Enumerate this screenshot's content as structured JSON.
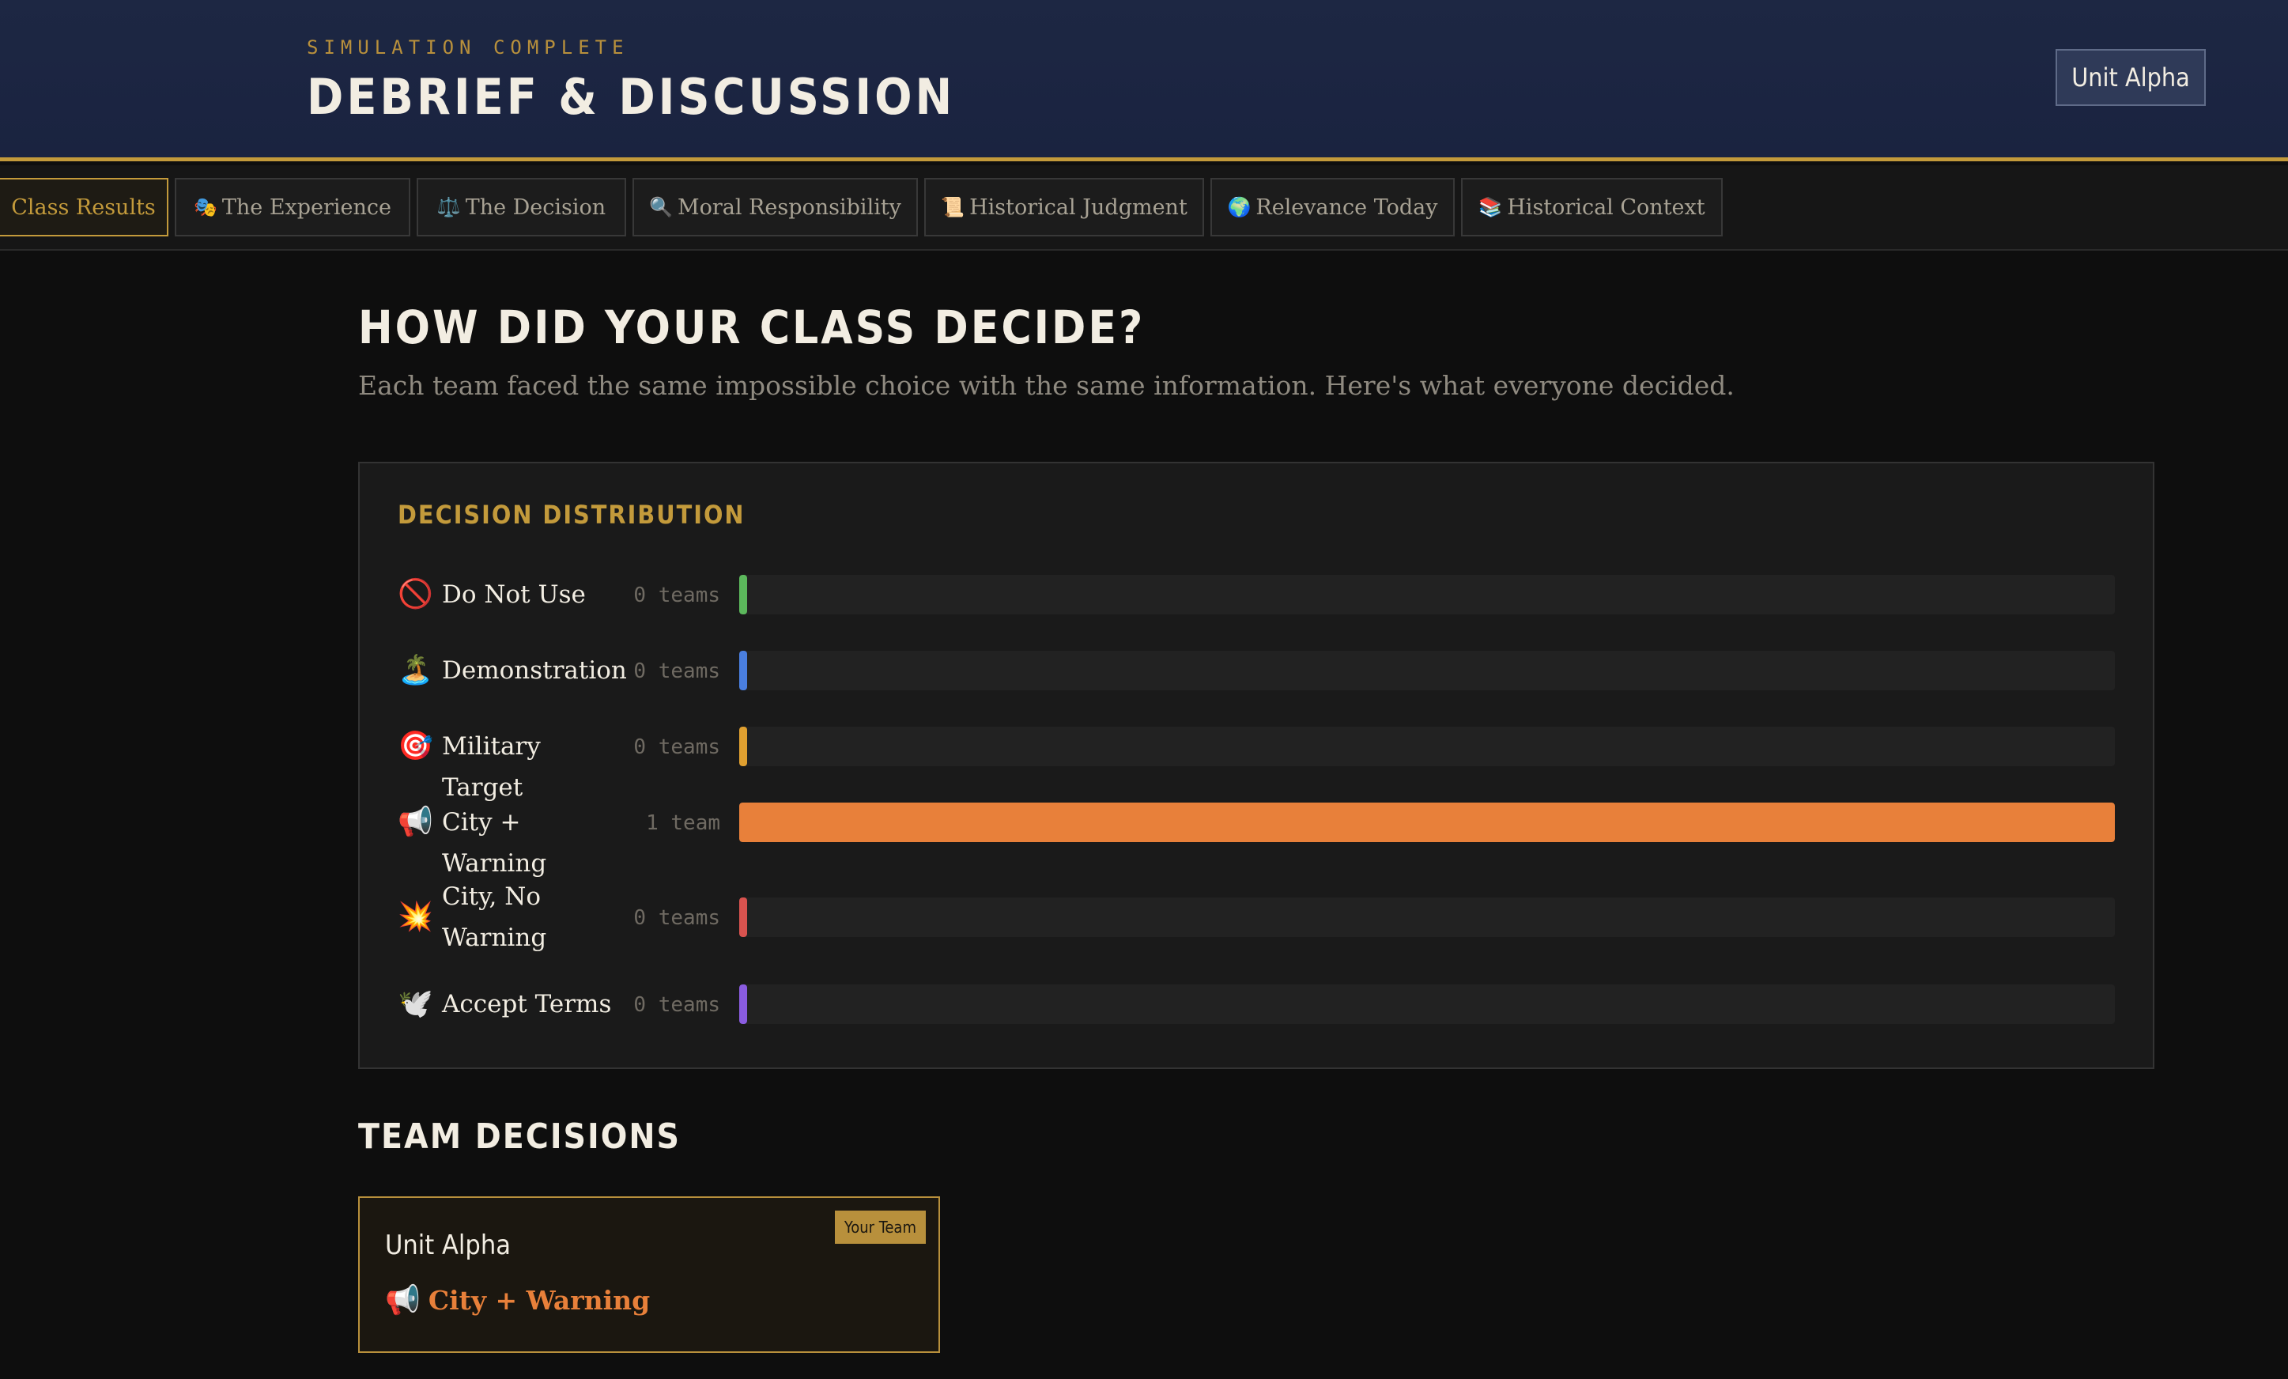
{
  "header": {
    "eyebrow": "SIMULATION COMPLETE",
    "title": "DEBRIEF & DISCUSSION",
    "unit": "Unit Alpha"
  },
  "tabs": [
    {
      "label": "Class Results",
      "icon": "",
      "icon_name": "",
      "active": true
    },
    {
      "label": "The Experience",
      "icon": "🎭",
      "icon_name": "theater-masks-icon",
      "active": false
    },
    {
      "label": "The Decision",
      "icon": "⚖️",
      "icon_name": "scales-icon",
      "active": false
    },
    {
      "label": "Moral Responsibility",
      "icon": "🔍",
      "icon_name": "magnifier-icon",
      "active": false
    },
    {
      "label": "Historical Judgment",
      "icon": "📜",
      "icon_name": "scroll-icon",
      "active": false
    },
    {
      "label": "Relevance Today",
      "icon": "🌍",
      "icon_name": "globe-icon",
      "active": false
    },
    {
      "label": "Historical Context",
      "icon": "📚",
      "icon_name": "books-icon",
      "active": false
    }
  ],
  "main": {
    "title": "HOW DID YOUR CLASS DECIDE?",
    "subtitle": "Each team faced the same impossible choice with the same information. Here's what everyone decided."
  },
  "distribution": {
    "title": "DECISION DISTRIBUTION",
    "max_teams": 1,
    "options": [
      {
        "icon": "🚫",
        "icon_name": "prohibited-icon",
        "label": "Do Not Use",
        "count": 0,
        "count_text": "0 teams",
        "color": "#5cb85c"
      },
      {
        "icon": "🏝️",
        "icon_name": "island-icon",
        "label": "Demonstration",
        "count": 0,
        "count_text": "0 teams",
        "color": "#4a7fe0"
      },
      {
        "icon": "🎯",
        "icon_name": "target-icon",
        "label": "Military Target",
        "count": 0,
        "count_text": "0 teams",
        "color": "#e0a030"
      },
      {
        "icon": "📢",
        "icon_name": "megaphone-icon",
        "label": "City + Warning",
        "count": 1,
        "count_text": "1 team",
        "color": "#e8803a"
      },
      {
        "icon": "💥",
        "icon_name": "explosion-icon",
        "label": "City, No Warning",
        "count": 0,
        "count_text": "0 teams",
        "color": "#d9534f"
      },
      {
        "icon": "🕊️",
        "icon_name": "dove-icon",
        "label": "Accept Terms",
        "count": 0,
        "count_text": "0 teams",
        "color": "#8a5ce0"
      }
    ]
  },
  "teams": {
    "title": "TEAM DECISIONS",
    "cards": [
      {
        "name": "Unit Alpha",
        "badge": "Your Team",
        "decision_icon": "📢",
        "decision_icon_name": "megaphone-icon",
        "decision": "City + Warning",
        "color": "#e8803a"
      }
    ]
  }
}
